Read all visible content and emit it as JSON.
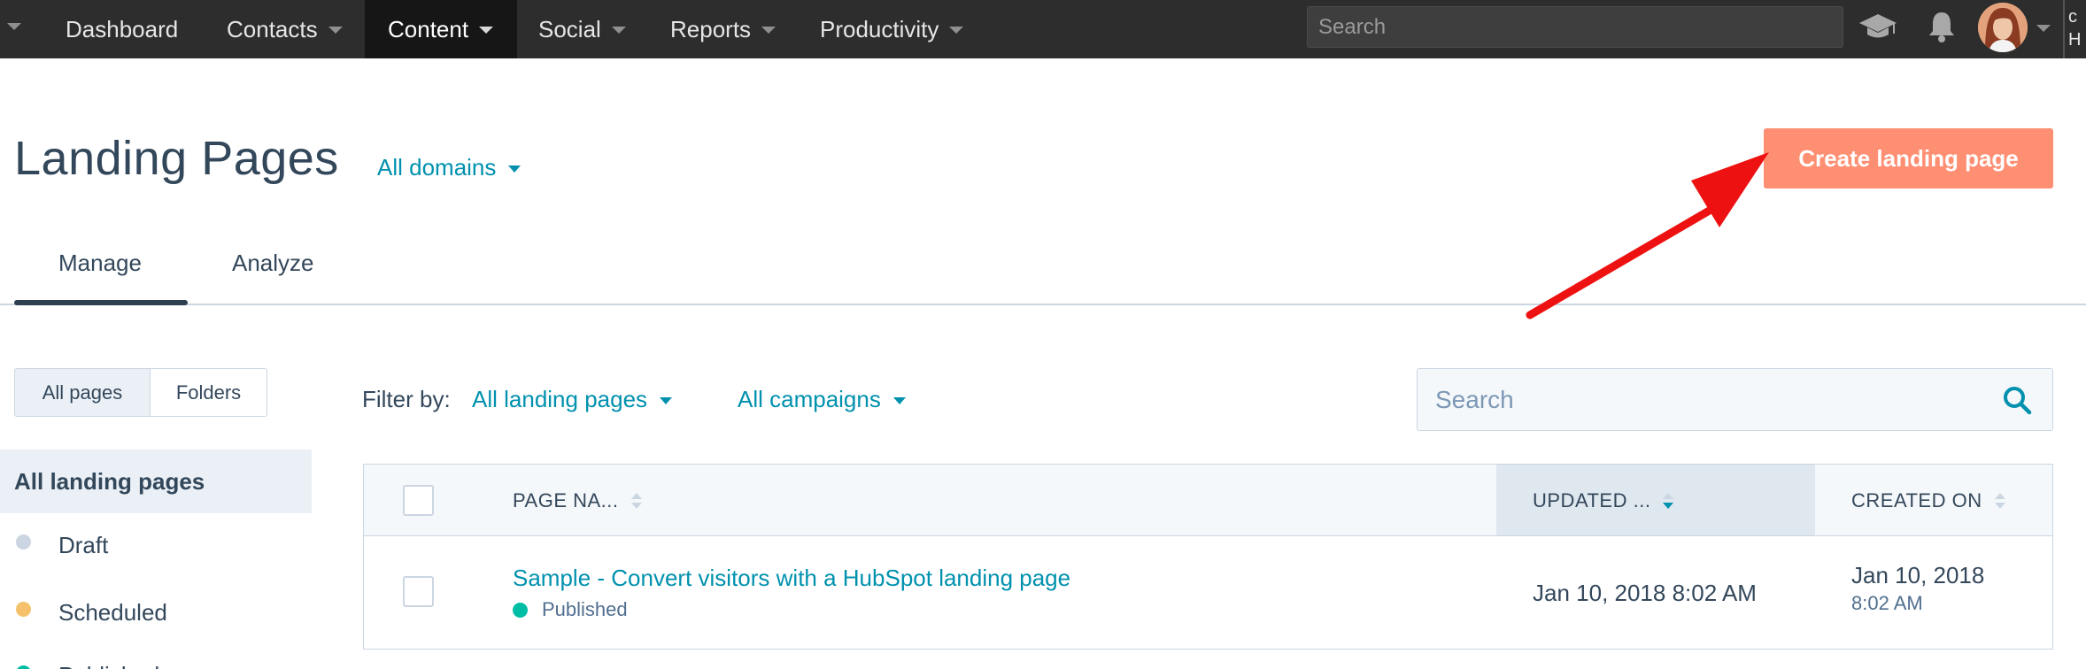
{
  "topnav": {
    "items": [
      {
        "label": "Dashboard"
      },
      {
        "label": "Contacts"
      },
      {
        "label": "Content"
      },
      {
        "label": "Social"
      },
      {
        "label": "Reports"
      },
      {
        "label": "Productivity"
      }
    ],
    "search_placeholder": "Search",
    "edge_text_1": "c",
    "edge_text_2": "H"
  },
  "header": {
    "title": "Landing Pages",
    "domain_filter": "All domains",
    "create_button": "Create landing page"
  },
  "tabs": [
    {
      "label": "Manage"
    },
    {
      "label": "Analyze"
    }
  ],
  "sidebar": {
    "segments": [
      {
        "label": "All pages"
      },
      {
        "label": "Folders"
      }
    ],
    "active_item": "All landing pages",
    "items": [
      {
        "label": "Draft",
        "dot_color": "#cbd6e2"
      },
      {
        "label": "Scheduled",
        "dot_color": "#f5c26b"
      },
      {
        "label": "Published",
        "dot_color": "#00bda5"
      }
    ]
  },
  "filters": {
    "label": "Filter by:",
    "pages_filter": "All landing pages",
    "campaign_filter": "All campaigns",
    "search_placeholder": "Search"
  },
  "table": {
    "columns": [
      {
        "label": "PAGE NA..."
      },
      {
        "label": "UPDATED ..."
      },
      {
        "label": "CREATED ON"
      }
    ],
    "rows": [
      {
        "name": "Sample - Convert visitors with a HubSpot landing page",
        "status": "Published",
        "updated": "Jan 10, 2018 8:02 AM",
        "created_date": "Jan 10, 2018",
        "created_time": "8:02 AM"
      }
    ]
  },
  "colors": {
    "nav_bg": "#2d2d2d",
    "accent_link": "#0091ae",
    "create_button": "#ff8f73",
    "annotation_arrow": "#ee1111"
  }
}
